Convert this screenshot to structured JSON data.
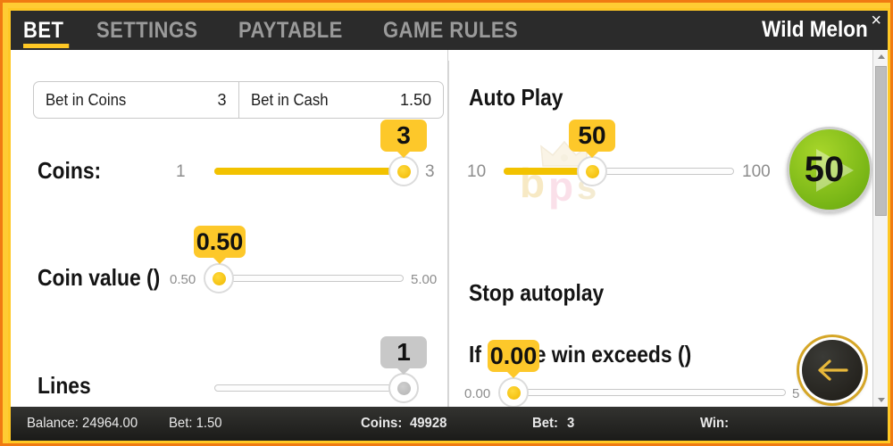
{
  "window": {
    "game_title": "Wild Melon",
    "close_label": "×"
  },
  "tabs": [
    {
      "label": "BET",
      "active": true
    },
    {
      "label": "SETTINGS",
      "active": false
    },
    {
      "label": "PAYTABLE",
      "active": false
    },
    {
      "label": "GAME RULES",
      "active": false
    }
  ],
  "bet_summary": {
    "coins_label": "Bet in Coins",
    "coins_value": "3",
    "cash_label": "Bet in Cash",
    "cash_value": "1.50"
  },
  "left_panel": {
    "coins": {
      "label": "Coins:",
      "min": "1",
      "max": "3",
      "value": "3",
      "bubble": "3",
      "fill_percent": 100,
      "enabled": true
    },
    "coin_value": {
      "label": "Coin value ()",
      "min": "0.50",
      "max": "5.00",
      "value": "0.50",
      "bubble": "0.50",
      "fill_percent": 0,
      "enabled": true
    },
    "lines": {
      "label": "Lines",
      "min": "",
      "max": "",
      "value": "1",
      "bubble": "1",
      "fill_percent": 100,
      "enabled": false
    }
  },
  "right_panel": {
    "auto_play": {
      "title": "Auto Play",
      "min": "10",
      "max": "100",
      "value": "50",
      "bubble": "50",
      "fill_percent": 38,
      "play_button_label": "50"
    },
    "stop_autoplay_title": "Stop autoplay",
    "single_win": {
      "title": "If single win exceeds ()",
      "min": "0.00",
      "max": "5",
      "value": "0.00",
      "bubble": "0.00",
      "fill_percent": 0
    },
    "back_button_icon": "arrow-left-icon"
  },
  "watermark": {
    "text_b": "b",
    "text_p": "p",
    "text_s": "s",
    "crown": "crown-icon"
  },
  "status_bar": {
    "balance_label": "Balance: 24964.00",
    "bet_cash_label": "Bet: 1.50",
    "coins_label": "Coins:",
    "coins_value": "49928",
    "bet_label": "Bet:",
    "bet_value": "3",
    "win_label": "Win:",
    "win_value": ""
  },
  "colors": {
    "accent_yellow": "#fdc82a",
    "border_orange": "#f07a12",
    "header_dark": "#2b2b2b",
    "play_green": "#8cc61a",
    "gold_text": "#e8b83a"
  }
}
